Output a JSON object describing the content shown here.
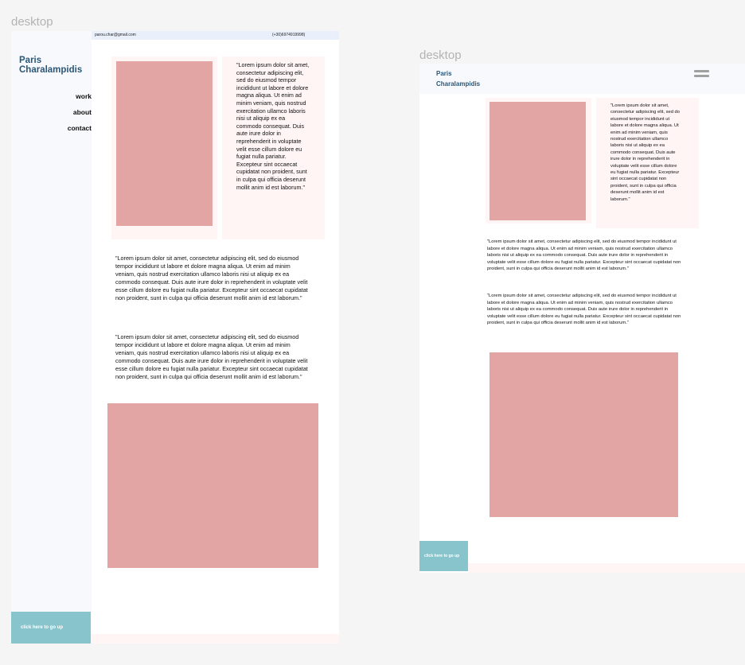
{
  "frames": [
    {
      "label": "desktop",
      "email": "parou.char@gmail.com",
      "phone": "(+30)6974919998)",
      "name_line1": "Paris",
      "name_line2": "Charalampidis",
      "nav": [
        "work",
        "about",
        "contact"
      ],
      "card_text": "\"Lorem ipsum dolor sit amet, consectetur adipiscing elit, sed do eiusmod tempor incididunt ut labore et dolore magna aliqua. Ut enim ad minim veniam, quis nostrud exercitation ullamco laboris nisi ut aliquip ex ea commodo consequat. Duis aute irure dolor in reprehenderit in voluptate velit esse cillum dolore eu fugiat nulla pariatur. Excepteur sint occaecat cupidatat non proident, sunt in culpa qui officia deserunt mollit anim id est laborum.\"",
      "paragraphs": [
        "\"Lorem ipsum dolor sit amet, consectetur adipiscing elit, sed do eiusmod tempor incididunt ut labore et dolore magna aliqua. Ut enim ad minim veniam, quis nostrud exercitation ullamco laboris nisi ut aliquip ex ea commodo consequat. Duis aute irure dolor in reprehenderit in voluptate velit esse cillum dolore eu fugiat nulla pariatur. Excepteur sint occaecat cupidatat non proident, sunt in culpa qui officia deserunt mollit anim id est laborum.\"",
        "\"Lorem ipsum dolor sit amet, consectetur adipiscing elit, sed do eiusmod tempor incididunt ut labore et dolore magna aliqua. Ut enim ad minim veniam, quis nostrud exercitation ullamco laboris nisi ut aliquip ex ea commodo consequat. Duis aute irure dolor in reprehenderit in voluptate velit esse cillum dolore eu fugiat nulla pariatur. Excepteur sint occaecat cupidatat non proident, sunt in culpa qui officia deserunt mollit anim id est laborum.\""
      ],
      "go_up": "click here to go up"
    },
    {
      "label": "desktop",
      "name_line1": "Paris",
      "name_line2": "Charalampidis",
      "card_text": "\"Lorem ipsum dolor sit amet, consectetur adipiscing elit, sed do eiusmod tempor incididunt ut labore et dolore magna aliqua. Ut enim ad minim veniam, quis nostrud exercitation ullamco laboris nisi ut aliquip ex ea commodo consequat. Duis aute irure dolor in reprehenderit in voluptate velit esse cillum dolore eu fugiat nulla pariatur. Excepteur sint occaecat cupidatat non proident, sunt in culpa qui officia deserunt mollit anim id est laborum.\"",
      "paragraphs": [
        "\"Lorem ipsum dolor sit amet, consectetur adipiscing elit, sed do eiusmod tempor incididunt ut labore et dolore magna aliqua. Ut enim ad minim veniam, quis nostrud exercitation ullamco laboris nisi ut aliquip ex ea commodo consequat. Duis aute irure dolor in reprehenderit in voluptate velit esse cillum dolore eu fugiat nulla pariatur. Excepteur sint occaecat cupidatat non proident, sunt in culpa qui officia deserunt mollit anim id est laborum.\"",
        "\"Lorem ipsum dolor sit amet, consectetur adipiscing elit, sed do eiusmod tempor incididunt ut labore et dolore magna aliqua. Ut enim ad minim veniam, quis nostrud exercitation ullamco laboris nisi ut aliquip ex ea commodo consequat. Duis aute irure dolor in reprehenderit in voluptate velit esse cillum dolore eu fugiat nulla pariatur. Excepteur sint occaecat cupidatat non proident, sunt in culpa qui officia deserunt mollit anim id est laborum.\""
      ],
      "go_up": "click here to go up"
    }
  ]
}
